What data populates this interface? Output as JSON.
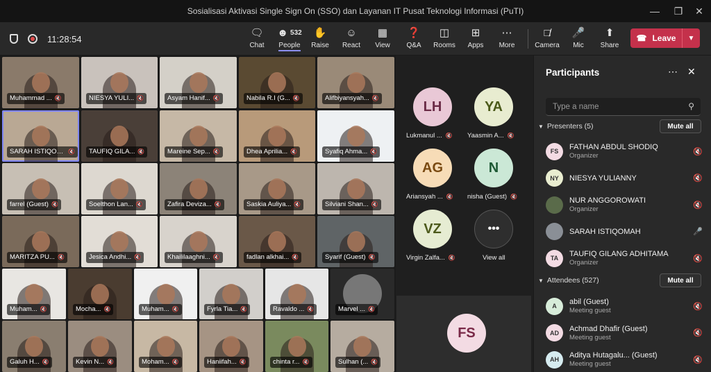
{
  "window": {
    "title": "Sosialisasi Aktivasi Single Sign On (SSO) dan Layanan IT Pusat Teknologi Informasi (PuTI)"
  },
  "toolbar": {
    "time": "11:28:54",
    "people_count": "532",
    "buttons": {
      "chat": "Chat",
      "people": "People",
      "raise": "Raise",
      "react": "React",
      "view": "View",
      "qa": "Q&A",
      "rooms": "Rooms",
      "apps": "Apps",
      "more": "More",
      "camera": "Camera",
      "mic": "Mic",
      "share": "Share"
    },
    "leave": "Leave"
  },
  "grid": {
    "tiles": [
      {
        "name": "Muhammad ...",
        "bg": "#8a7a6a"
      },
      {
        "name": "NIESYA YULI...",
        "bg": "#c9c2bc"
      },
      {
        "name": "Asyam Hanif...",
        "bg": "#d4d0c8"
      },
      {
        "name": "Nabila R.I (G...",
        "bg": "#5a4a32"
      },
      {
        "name": "Alifbiyansyah...",
        "bg": "#9a8a78"
      },
      {
        "name": "SARAH ISTIQOM...",
        "bg": "#b9a894"
      },
      {
        "name": "TAUFIQ GILA...",
        "bg": "#4a3f38"
      },
      {
        "name": "Mareine Sep...",
        "bg": "#c6b8a6"
      },
      {
        "name": "Dhea Aprilia...",
        "bg": "#b89a7a"
      },
      {
        "name": "Syafiq Ahma...",
        "bg": "#eef1f3"
      },
      {
        "name": "farrel (Guest)",
        "bg": "#c7bfb4"
      },
      {
        "name": "Soelthon Lan...",
        "bg": "#ddd8d0"
      },
      {
        "name": "Zafira Deviza...",
        "bg": "#8c8378"
      },
      {
        "name": "Saskia Auliya...",
        "bg": "#a89988"
      },
      {
        "name": "Silviani Shan...",
        "bg": "#bdb6ae"
      },
      {
        "name": "MARITZA PU...",
        "bg": "#7a6a5a"
      },
      {
        "name": "Jesica Andhi...",
        "bg": "#e2ddd6"
      },
      {
        "name": "Khaililaaghni...",
        "bg": "#d8d3cc"
      },
      {
        "name": "fadlan alkhai...",
        "bg": "#6a5848"
      },
      {
        "name": "Syarif (Guest)",
        "bg": "#5f6466"
      },
      {
        "name": "Muham...",
        "bg": "#e8e6e2"
      },
      {
        "name": "Mocha...",
        "bg": "#4a3c30"
      },
      {
        "name": "Muham...",
        "bg": "#f0f0f0"
      },
      {
        "name": "Fyrla Tia...",
        "bg": "#d2cfcb"
      },
      {
        "name": "Ravaldo ...",
        "bg": "#e6e6e6"
      },
      {
        "name": "Marvel ...",
        "bg": "#2a2a2a"
      },
      {
        "name": "Galuh H...",
        "bg": "#8a7e70"
      },
      {
        "name": "Kevin N...",
        "bg": "#9b8d80"
      },
      {
        "name": "Moham...",
        "bg": "#c7b8a4"
      },
      {
        "name": "Haniifah...",
        "bg": "#a69484"
      },
      {
        "name": "chinta r...",
        "bg": "#7a8a5e"
      },
      {
        "name": "Sulhan (...",
        "bg": "#b6aca0"
      }
    ]
  },
  "avatars": [
    {
      "initials": "LH",
      "name": "Lukmanul ...",
      "bg": "#e9c8d6",
      "fg": "#6b2b47"
    },
    {
      "initials": "YA",
      "name": "Yaasmin A...",
      "bg": "#e8ecd0",
      "fg": "#4b5a1a"
    },
    {
      "initials": "AG",
      "name": "Ariansyah ...",
      "bg": "#f7dcb7",
      "fg": "#7a4a12"
    },
    {
      "initials": "N",
      "name": "nisha (Guest)",
      "bg": "#cbe8d6",
      "fg": "#1e5a35"
    },
    {
      "initials": "VZ",
      "name": "Virgin Zalfa...",
      "bg": "#e6ecd2",
      "fg": "#4d5a1c"
    },
    {
      "initials": "•••",
      "name": "View all",
      "bg": "#2e2e2e",
      "fg": "#ffffff"
    }
  ],
  "featured": {
    "initials": "FS",
    "bg": "#f3dbe3",
    "fg": "#7a2a48"
  },
  "panel": {
    "title": "Participants",
    "search_placeholder": "Type a name",
    "presenters_label": "Presenters (5)",
    "attendees_label": "Attendees (527)",
    "mute_all": "Mute all",
    "presenters": [
      {
        "initials": "FS",
        "name": "FATHAN ABDUL SHODIQ",
        "role": "Organizer",
        "bg": "#f3dbe3"
      },
      {
        "initials": "NY",
        "name": "NIESYA YULIANNY",
        "role": "",
        "bg": "#e9edd0"
      },
      {
        "initials": "",
        "name": "NUR ANGGOROWATI",
        "role": "Organizer",
        "bg": "#5a6b4a"
      },
      {
        "initials": "",
        "name": "SARAH ISTIQOMAH",
        "role": "",
        "bg": "#8a8f96"
      },
      {
        "initials": "TA",
        "name": "TAUFIQ GILANG ADHITAMA",
        "role": "Organizer",
        "bg": "#f3dbe3"
      }
    ],
    "attendees": [
      {
        "initials": "A",
        "name": "abil (Guest)",
        "role": "Meeting guest",
        "bg": "#d7ecd9"
      },
      {
        "initials": "AD",
        "name": "Achmad Dhafir (Guest)",
        "role": "Meeting guest",
        "bg": "#f3dbe3"
      },
      {
        "initials": "AH",
        "name": "Aditya Hutagalu...  (Guest)",
        "role": "Meeting guest",
        "bg": "#d6ecf0"
      }
    ]
  }
}
